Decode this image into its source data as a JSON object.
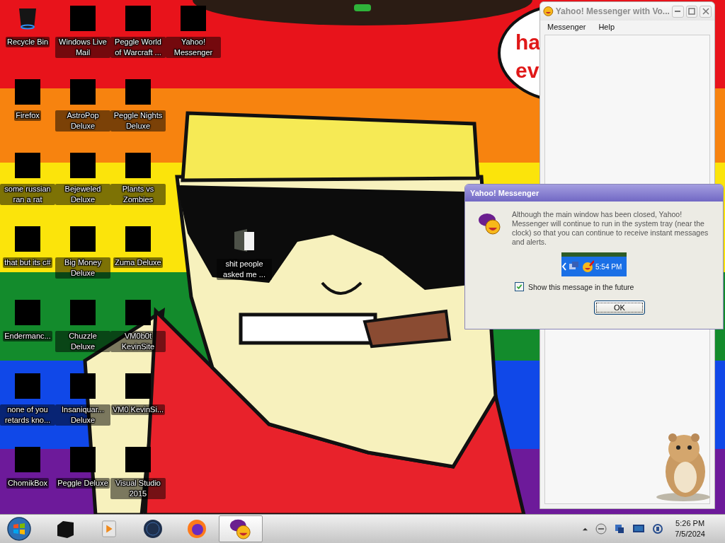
{
  "desktop": {
    "icons": [
      {
        "label": "Recycle Bin",
        "kind": "bin"
      },
      {
        "label": "Firefox",
        "kind": "redacted"
      },
      {
        "label": "some russian ran a rat",
        "kind": "redacted"
      },
      {
        "label": "that but its c#",
        "kind": "redacted"
      },
      {
        "label": "Endermanc...",
        "kind": "redacted"
      },
      {
        "label": "none of you retards kno...",
        "kind": "redacted"
      },
      {
        "label": "ChomikBox",
        "kind": "redacted"
      },
      {
        "label": "Windows Live Mail",
        "kind": "redacted"
      },
      {
        "label": "AstroPop Deluxe",
        "kind": "redacted"
      },
      {
        "label": "Bejeweled Deluxe",
        "kind": "redacted"
      },
      {
        "label": "Big Money Deluxe",
        "kind": "redacted"
      },
      {
        "label": "Chuzzle Deluxe",
        "kind": "redacted"
      },
      {
        "label": "Insaniquar... Deluxe",
        "kind": "redacted"
      },
      {
        "label": "Peggle Deluxe",
        "kind": "redacted"
      },
      {
        "label": "Peggle World of Warcraft ...",
        "kind": "redacted"
      },
      {
        "label": "Peggle Nights Deluxe",
        "kind": "redacted"
      },
      {
        "label": "Plants vs Zombies",
        "kind": "redacted"
      },
      {
        "label": "Zuma Deluxe",
        "kind": "redacted"
      },
      {
        "label": "VM0b0t KevinSite",
        "kind": "redacted"
      },
      {
        "label": "VM0 KevinSi...",
        "kind": "redacted"
      },
      {
        "label": "Visual Studio 2015",
        "kind": "redacted"
      },
      {
        "label": "Yahoo! Messenger",
        "kind": "redacted"
      }
    ],
    "loose_icon": {
      "label": "shit people asked me ...",
      "kind": "folder"
    }
  },
  "wallpaper": {
    "bubble_lines": [
      "ha",
      "ev"
    ]
  },
  "messenger_window": {
    "title": "Yahoo! Messenger with Vo...",
    "menu": [
      "Messenger",
      "Help"
    ]
  },
  "dialog": {
    "title": "Yahoo! Messenger",
    "message": "Although the main window has been closed, Yahoo! Messenger will continue to run in the system tray (near the clock) so that you can continue to receive instant messages and alerts.",
    "tray_preview_time": "5:54 PM",
    "checkbox": {
      "label": "Show this message in the future",
      "checked": true
    },
    "button": "OK"
  },
  "taskbar": {
    "apps": [
      {
        "kind": "cube",
        "selected": false
      },
      {
        "kind": "player",
        "selected": false
      },
      {
        "kind": "globe",
        "selected": false
      },
      {
        "kind": "firefox",
        "selected": false
      },
      {
        "kind": "yahoo",
        "selected": true
      }
    ],
    "clock": {
      "time": "5:26 PM",
      "date": "7/5/2024"
    }
  }
}
